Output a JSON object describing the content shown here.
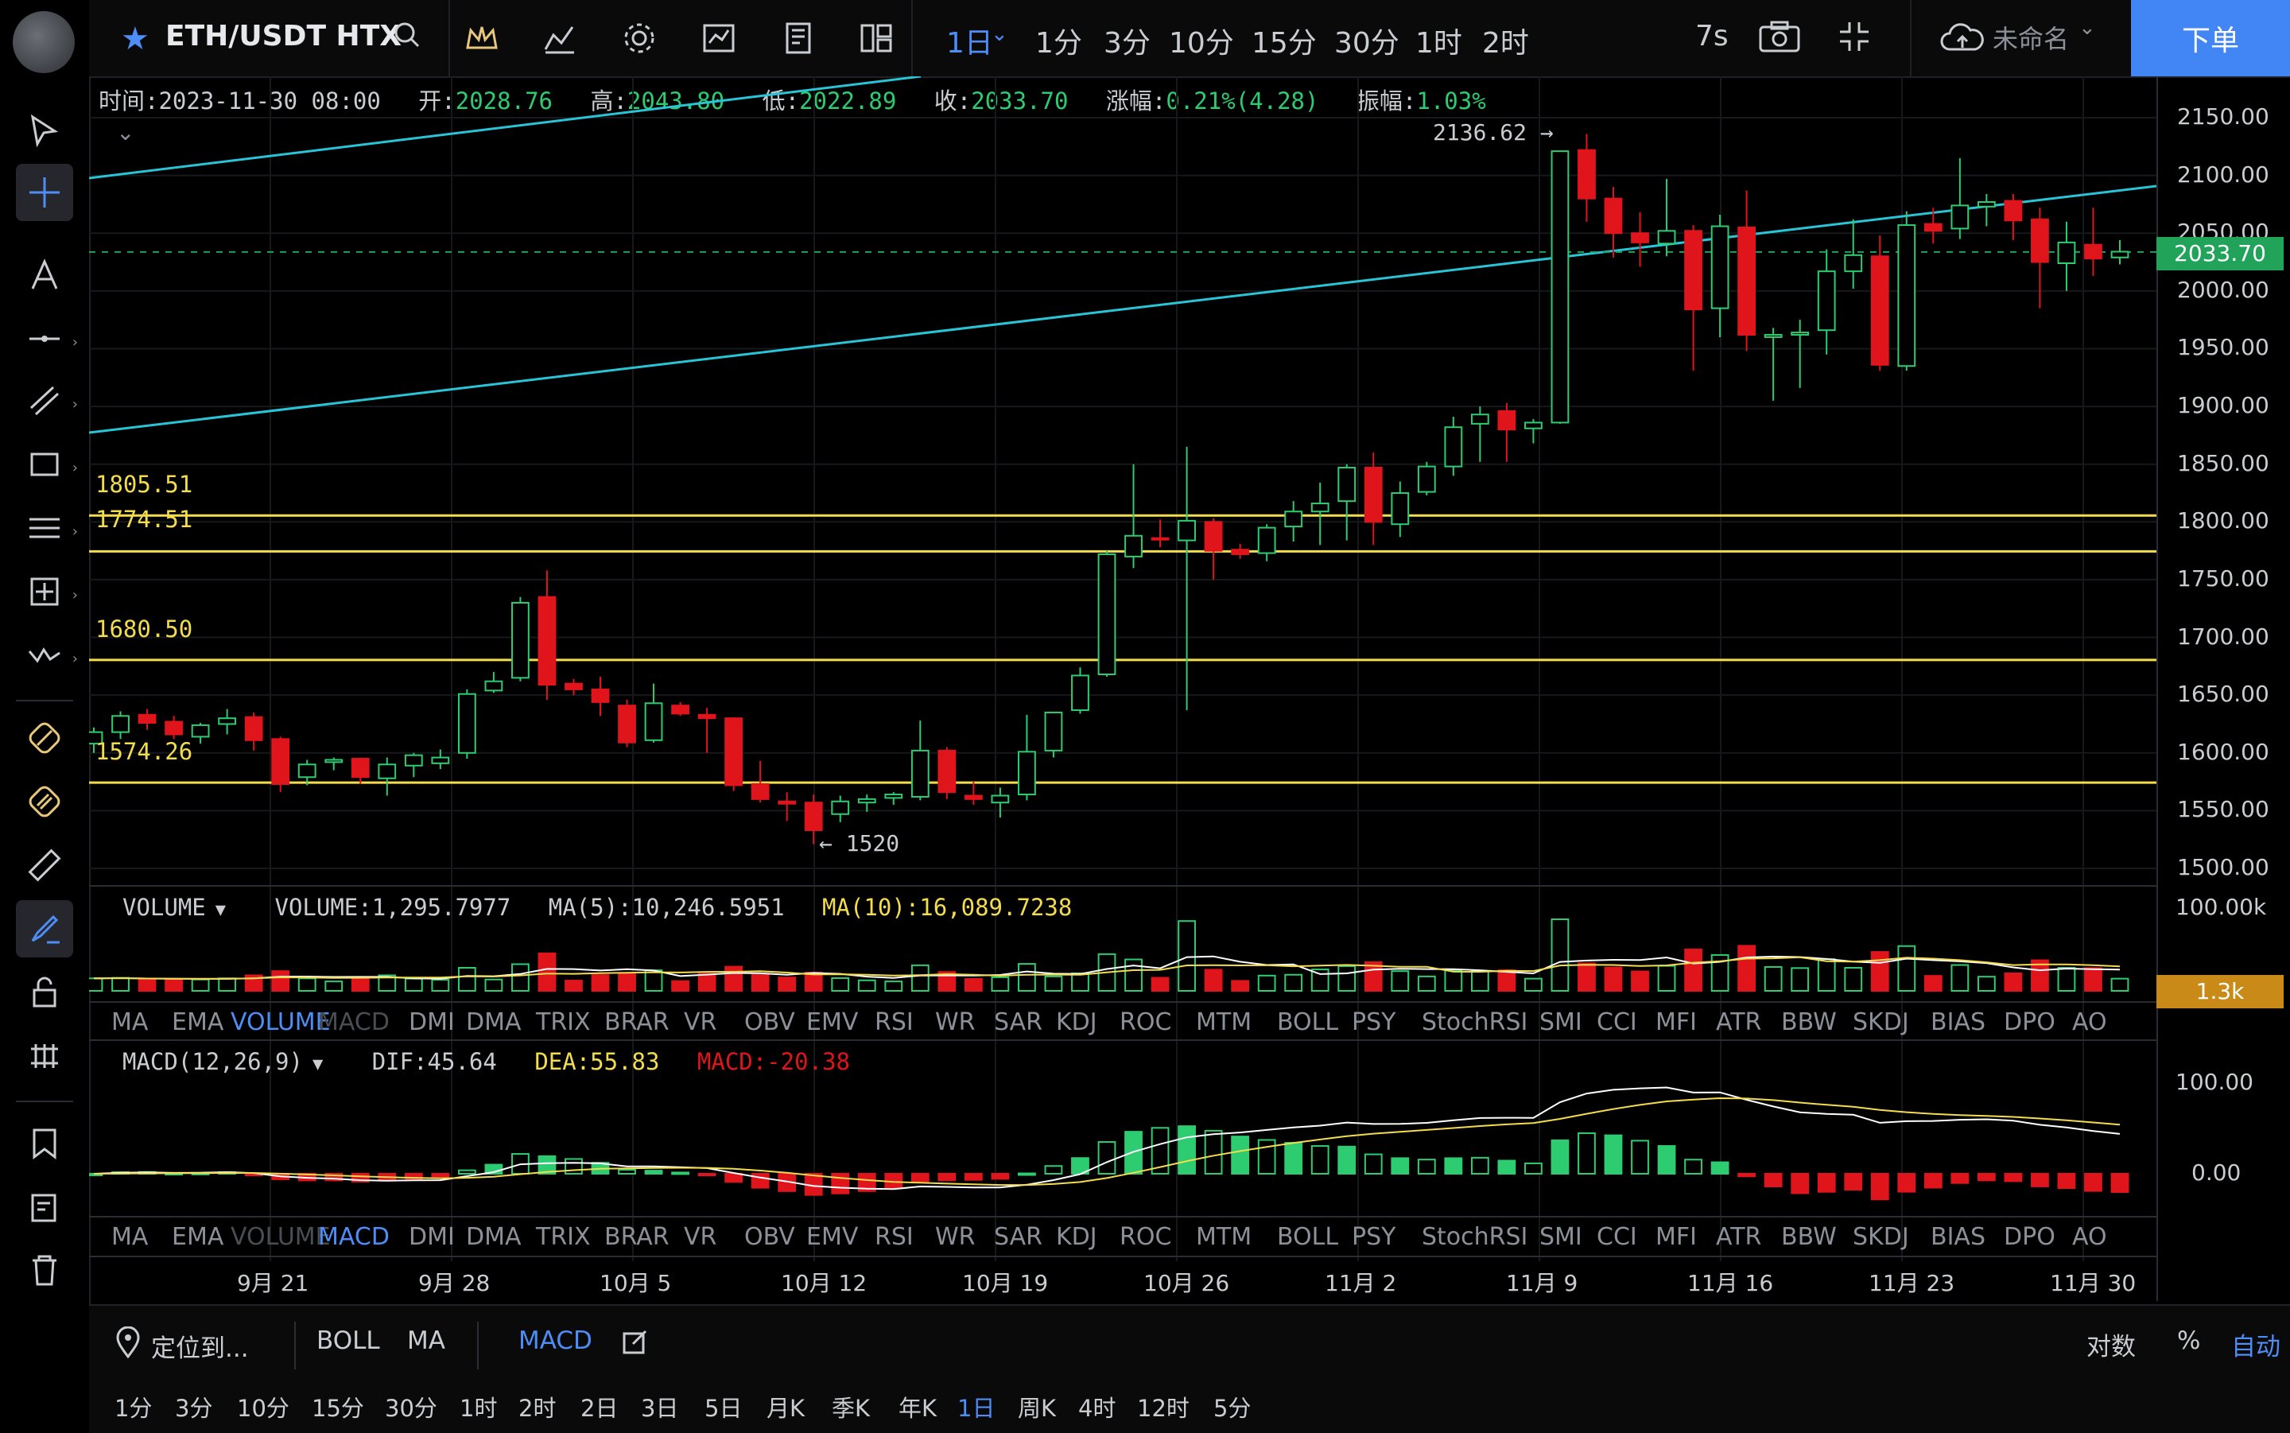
{
  "header": {
    "symbol": "ETH/USDT HTX",
    "intervals": [
      "1日",
      "1分",
      "3分",
      "10分",
      "15分",
      "30分",
      "1时",
      "2时"
    ],
    "active_interval": "1日",
    "countdown": "7s",
    "account_label": "未命名",
    "order_button": "下单"
  },
  "ohlc": {
    "time_label": "时间:",
    "time": "2023-11-30 08:00",
    "open_label": "开:",
    "open": "2028.76",
    "high_label": "高:",
    "high": "2043.80",
    "low_label": "低:",
    "low": "2022.89",
    "close_label": "收:",
    "close": "2033.70",
    "change_label": "涨幅:",
    "change": "0.21%(4.28)",
    "amp_label": "振幅:",
    "amp": "1.03%"
  },
  "price_axis": {
    "ticks": [
      "2150.00",
      "2100.00",
      "2050.00",
      "2000.00",
      "1950.00",
      "1900.00",
      "1850.00",
      "1800.00",
      "1750.00",
      "1700.00",
      "1650.00",
      "1600.00",
      "1550.00",
      "1500.00"
    ],
    "current_price": "2033.70"
  },
  "annotations": {
    "levels": [
      "1805.51",
      "1774.51",
      "1680.50",
      "1574.26"
    ],
    "high_marker": "2136.62",
    "low_marker": "1520"
  },
  "volume_pane": {
    "name": "VOLUME",
    "value": "VOLUME:1,295.7977",
    "ma5": "MA(5):10,246.5951",
    "ma10": "MA(10):16,089.7238",
    "axis_top": "100.00k",
    "current": "1.3k"
  },
  "macd_pane": {
    "name": "MACD(12,26,9)",
    "dif": "DIF:45.64",
    "dea": "DEA:55.83",
    "macd": "MACD:-20.38",
    "axis": [
      "100.00",
      "0.00"
    ]
  },
  "indicators": [
    "MA",
    "EMA",
    "VOLUME",
    "MACD",
    "DMI",
    "DMA",
    "TRIX",
    "BRAR",
    "VR",
    "OBV",
    "EMV",
    "RSI",
    "WR",
    "SAR",
    "KDJ",
    "ROC",
    "MTM",
    "BOLL",
    "PSY",
    "StochRSI",
    "SMI",
    "CCI",
    "MFI",
    "ATR",
    "BBW",
    "SKDJ",
    "BIAS",
    "DPO",
    "AO"
  ],
  "dates": [
    "9月 21",
    "9月 28",
    "10月 5",
    "10月 12",
    "10月 19",
    "10月 26",
    "11月 2",
    "11月 9",
    "11月 16",
    "11月 23",
    "11月 30"
  ],
  "bottom": {
    "locate": "定位到...",
    "boll": "BOLL",
    "ma": "MA",
    "macd": "MACD",
    "log": "对数",
    "percent": "%",
    "auto": "自动",
    "periods": [
      "1分",
      "3分",
      "10分",
      "15分",
      "30分",
      "1时",
      "2时",
      "2日",
      "3日",
      "5日",
      "月K",
      "季K",
      "年K",
      "1日",
      "周K",
      "4时",
      "12时",
      "5分"
    ],
    "active_period": "1日"
  },
  "colors": {
    "up": "#2ecc71",
    "down": "#e0141b",
    "accent": "#4285f4",
    "level": "#f3dc4d",
    "trend": "#27c5d6"
  },
  "chart_data": {
    "type": "candlestick",
    "ylim": [
      1480,
      2170
    ],
    "candles": [
      [
        1608,
        1622,
        1600,
        1618
      ],
      [
        1618,
        1636,
        1612,
        1632
      ],
      [
        1633,
        1638,
        1620,
        1626
      ],
      [
        1627,
        1632,
        1612,
        1616
      ],
      [
        1614,
        1626,
        1608,
        1624
      ],
      [
        1625,
        1638,
        1616,
        1630
      ],
      [
        1631,
        1635,
        1602,
        1611
      ],
      [
        1612,
        1614,
        1566,
        1573
      ],
      [
        1579,
        1594,
        1572,
        1590
      ],
      [
        1592,
        1596,
        1585,
        1594
      ],
      [
        1595,
        1596,
        1573,
        1579
      ],
      [
        1578,
        1596,
        1563,
        1590
      ],
      [
        1589,
        1600,
        1579,
        1598
      ],
      [
        1591,
        1603,
        1586,
        1596
      ],
      [
        1600,
        1655,
        1595,
        1651
      ],
      [
        1654,
        1670,
        1652,
        1662
      ],
      [
        1665,
        1735,
        1662,
        1730
      ],
      [
        1735,
        1758,
        1646,
        1659
      ],
      [
        1660,
        1664,
        1650,
        1655
      ],
      [
        1655,
        1666,
        1632,
        1644
      ],
      [
        1641,
        1646,
        1605,
        1609
      ],
      [
        1611,
        1660,
        1609,
        1643
      ],
      [
        1641,
        1644,
        1632,
        1634
      ],
      [
        1633,
        1639,
        1600,
        1630
      ],
      [
        1630,
        1631,
        1567,
        1572
      ],
      [
        1573,
        1593,
        1557,
        1560
      ],
      [
        1558,
        1566,
        1541,
        1556
      ],
      [
        1557,
        1564,
        1521,
        1533
      ],
      [
        1547,
        1563,
        1540,
        1558
      ],
      [
        1557,
        1564,
        1549,
        1560
      ],
      [
        1561,
        1566,
        1555,
        1564
      ],
      [
        1562,
        1628,
        1559,
        1602
      ],
      [
        1602,
        1605,
        1560,
        1566
      ],
      [
        1563,
        1575,
        1555,
        1560
      ],
      [
        1557,
        1570,
        1544,
        1563
      ],
      [
        1564,
        1633,
        1559,
        1601
      ],
      [
        1602,
        1625,
        1596,
        1635
      ],
      [
        1637,
        1674,
        1634,
        1667
      ],
      [
        1668,
        1775,
        1666,
        1772
      ],
      [
        1770,
        1850,
        1760,
        1788
      ],
      [
        1786,
        1802,
        1778,
        1785
      ],
      [
        1784,
        1865,
        1637,
        1801
      ],
      [
        1800,
        1803,
        1750,
        1775
      ],
      [
        1776,
        1781,
        1768,
        1772
      ],
      [
        1773,
        1798,
        1766,
        1795
      ],
      [
        1796,
        1818,
        1783,
        1809
      ],
      [
        1809,
        1834,
        1780,
        1816
      ],
      [
        1818,
        1850,
        1784,
        1847
      ],
      [
        1847,
        1860,
        1780,
        1800
      ],
      [
        1798,
        1835,
        1787,
        1825
      ],
      [
        1826,
        1852,
        1823,
        1848
      ],
      [
        1848,
        1891,
        1840,
        1882
      ],
      [
        1885,
        1900,
        1852,
        1893
      ],
      [
        1896,
        1903,
        1852,
        1880
      ],
      [
        1881,
        1889,
        1868,
        1886
      ],
      [
        1886,
        2121,
        1885,
        2121
      ],
      [
        2122,
        2136,
        2060,
        2080
      ],
      [
        2080,
        2090,
        2029,
        2050
      ],
      [
        2050,
        2068,
        2021,
        2042
      ],
      [
        2041,
        2097,
        2030,
        2052
      ],
      [
        2052,
        2057,
        1931,
        1984
      ],
      [
        1985,
        2066,
        1960,
        2056
      ],
      [
        2055,
        2087,
        1948,
        1962
      ],
      [
        1960,
        1968,
        1905,
        1962
      ],
      [
        1962,
        1975,
        1916,
        1964
      ],
      [
        1966,
        2036,
        1945,
        2017
      ],
      [
        2017,
        2062,
        2002,
        2031
      ],
      [
        2030,
        2048,
        1931,
        1936
      ],
      [
        1935,
        2069,
        1931,
        2057
      ],
      [
        2058,
        2072,
        2041,
        2052
      ],
      [
        2054,
        2115,
        2045,
        2074
      ],
      [
        2073,
        2084,
        2056,
        2077
      ],
      [
        2078,
        2084,
        2044,
        2061
      ],
      [
        2062,
        2072,
        1985,
        2025
      ],
      [
        2024,
        2060,
        2000,
        2042
      ],
      [
        2040,
        2072,
        2013,
        2028
      ],
      [
        2029,
        2044,
        2023,
        2034
      ]
    ],
    "volume_ma5": 10246.5951,
    "volume_ma10": 16089.7238,
    "macd": {
      "dif": 45.64,
      "dea": 55.83,
      "macd": -20.38
    }
  }
}
